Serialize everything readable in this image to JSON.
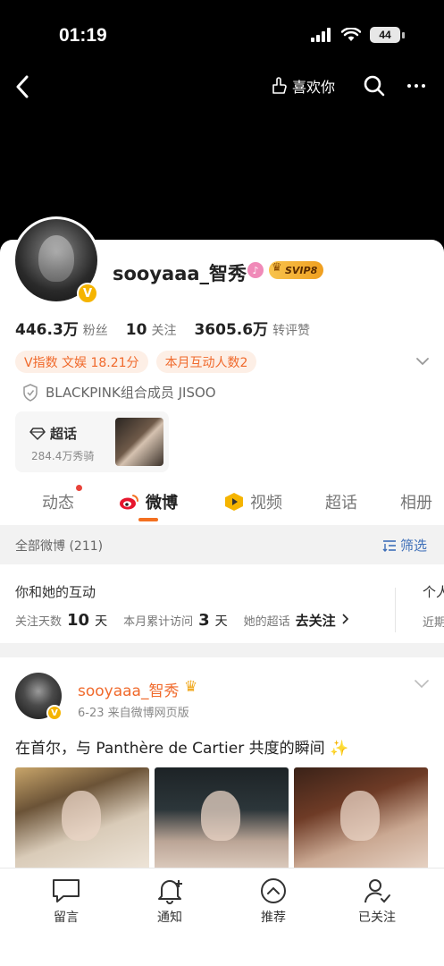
{
  "status": {
    "time": "01:19",
    "battery": "44"
  },
  "topbar": {
    "like_label": "喜欢你"
  },
  "profile": {
    "name": "sooyaaa_智秀",
    "vip_badge": "SVIP8",
    "stats": [
      {
        "num": "446.3万",
        "label": "粉丝"
      },
      {
        "num": "10",
        "label": "关注"
      },
      {
        "num": "3605.6万",
        "label": "转评赞"
      }
    ],
    "tags": [
      "V指数 文娱 18.21分",
      "本月互动人数2"
    ],
    "verified_text": "BLACKPINK组合成员 JISOO",
    "topic": {
      "title": "超话",
      "sub": "284.4万秀骑"
    }
  },
  "tabs": [
    "动态",
    "微博",
    "视频",
    "超话",
    "相册"
  ],
  "active_tab": "微博",
  "filter_bar": {
    "all_label": "全部微博 (211)",
    "filter_label": "筛选"
  },
  "interaction": {
    "title": "你和她的互动",
    "follow_days_label": "关注天数",
    "follow_days_value": "10",
    "follow_days_unit": "天",
    "visits_label": "本月累计访问",
    "visits_value": "3",
    "visits_unit": "天",
    "topic_label": "她的超话",
    "topic_link": "去关注",
    "side_title": "个人",
    "side_sub": "近期"
  },
  "post": {
    "author": "sooyaaa_智秀",
    "meta": "6-23  来自微博网页版",
    "text": "在首尔，与 Panthère de Cartier 共度的瞬间 ✨"
  },
  "bottom_bar": [
    "留言",
    "通知",
    "推荐",
    "已关注"
  ],
  "colors": {
    "accent": "#f37021",
    "link": "#3e6fb8",
    "vip": "#f5b400"
  }
}
